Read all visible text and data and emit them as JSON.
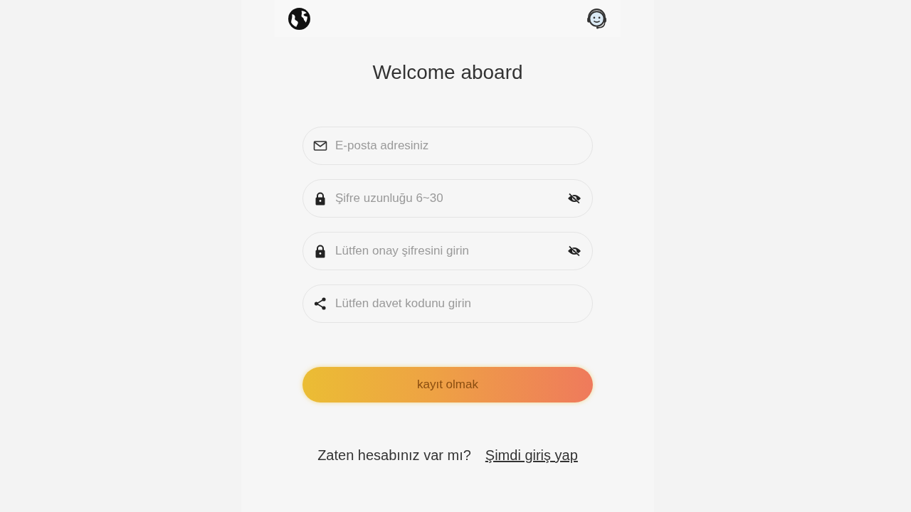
{
  "title": "Welcome aboard",
  "fields": [
    {
      "kind": "email",
      "placeholder": "E-posta adresiniz"
    },
    {
      "kind": "password",
      "placeholder": "Şifre uzunluğu 6~30"
    },
    {
      "kind": "password",
      "placeholder": "Lütfen onay şifresini girin"
    },
    {
      "kind": "invite",
      "placeholder": "Lütfen davet kodunu girin"
    }
  ],
  "submit_button": "kayıt olmak",
  "footer": {
    "prompt": "Zaten hesabınız var mı?",
    "link": "Şimdi giriş yap"
  }
}
